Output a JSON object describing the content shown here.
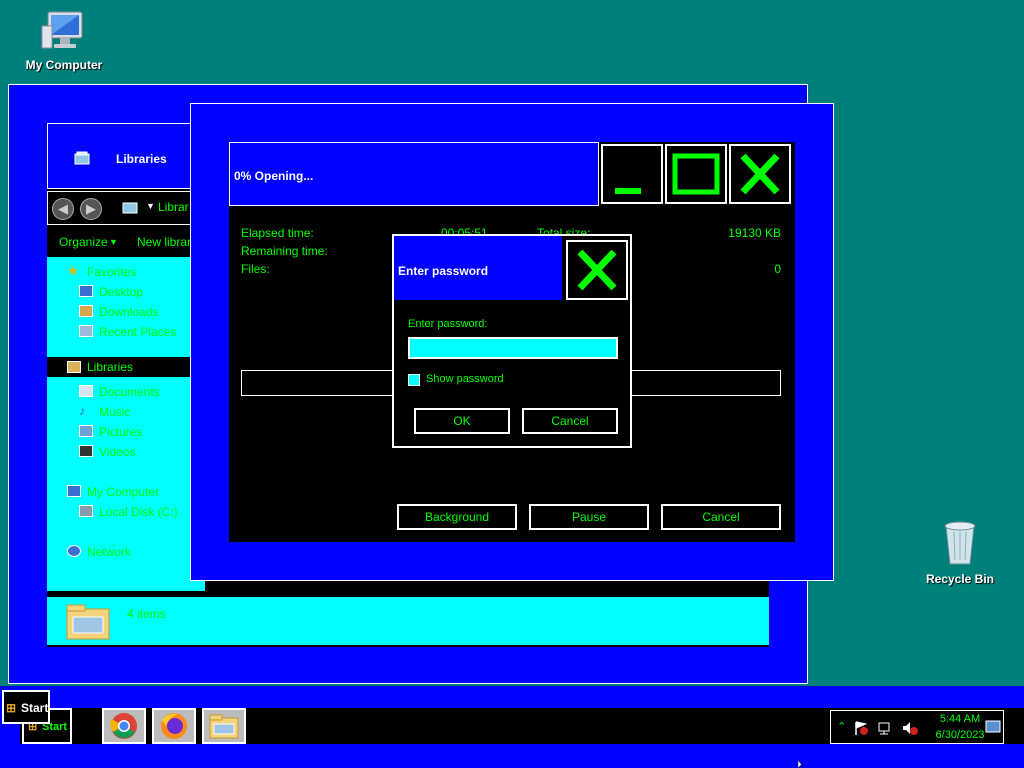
{
  "desktop": {
    "icons": [
      {
        "label": "My Computer",
        "icon": "computer-icon"
      },
      {
        "label": "Recycle Bin",
        "icon": "recycle-bin-icon"
      }
    ]
  },
  "explorer": {
    "title": "Libraries",
    "address": "Librar",
    "toolbar": {
      "organize": "Organize",
      "organize_arrow": "▼",
      "new_library": "New library"
    },
    "nav": {
      "favorites": "Favorites",
      "desktop": "Desktop",
      "downloads": "Downloads",
      "recent_places": "Recent Places",
      "libraries": "Libraries",
      "documents": "Documents",
      "music": "Music",
      "pictures": "Pictures",
      "videos": "Videos",
      "my_computer": "My Computer",
      "local_disk": "Local Disk (C:)",
      "network": "Network"
    },
    "status": "4 items"
  },
  "progress_dialog": {
    "title": "0% Opening...",
    "elapsed_label": "Elapsed time:",
    "elapsed_value": "00:05:51",
    "remaining_label": "Remaining time:",
    "files_label": "Files:",
    "files_value": "0",
    "total_size_label": "Total size:",
    "total_size_value": "19130 KB",
    "progress": 0,
    "buttons": {
      "background": "Background",
      "pause": "Pause",
      "cancel": "Cancel"
    },
    "caption": {
      "minimize": "_",
      "maximize": "□",
      "close": "X"
    }
  },
  "password_dialog": {
    "title": "Enter password",
    "field_label": "Enter password:",
    "value": "",
    "show_password_label": "Show password",
    "show_password_checked": false,
    "ok": "OK",
    "cancel": "Cancel"
  },
  "taskbar": {
    "start_label": "Start",
    "apps": [
      "chrome-icon",
      "firefox-icon",
      "file-explorer-icon"
    ],
    "clock_time": "5:44 AM",
    "clock_date": "6/30/2023",
    "tray_icons": [
      "chevron-up-icon",
      "action-center-flag-icon",
      "network-icon",
      "volume-muted-icon",
      "show-desktop-icon"
    ]
  },
  "colors": {
    "accent_blue": "#0000ff",
    "text_green": "#00ff00",
    "panel_cyan": "#00ffff",
    "desktop_teal": "#00807a"
  }
}
